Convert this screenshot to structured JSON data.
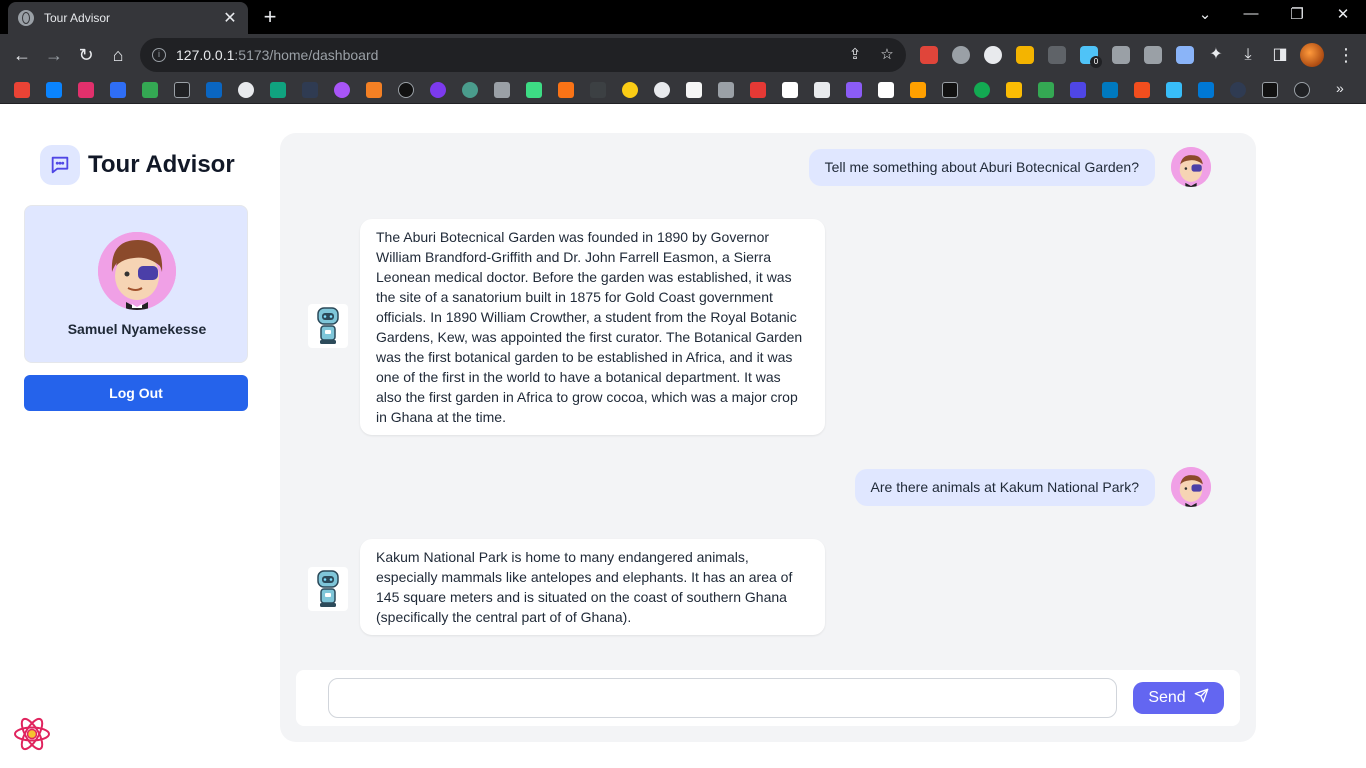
{
  "browser": {
    "tab_title": "Tour Advisor",
    "url_host": "127.0.0.1",
    "url_path": ":5173/home/dashboard",
    "extension_badge": "0"
  },
  "sidebar": {
    "brand_title": "Tour Advisor",
    "user_name": "Samuel Nyamekesse",
    "logout_label": "Log Out"
  },
  "chat": {
    "messages": [
      {
        "role": "user",
        "text": "Tell me something about Aburi Botecnical Garden?"
      },
      {
        "role": "bot",
        "text": "The Aburi Botecnical Garden was founded in 1890 by Governor William Brandford-Griffith and Dr. John Farrell Easmon, a Sierra Leonean medical doctor. Before the garden was established, it was the site of a sanatorium built in 1875 for Gold Coast government officials. In 1890 William Crowther, a student from the Royal Botanic Gardens, Kew, was appointed the first curator. The Botanical Garden was the first botanical garden to be established in Africa, and it was one of the first in the world to have a botanical department. It was also the first garden in Africa to grow cocoa, which was a major crop in Ghana at the time."
      },
      {
        "role": "user",
        "text": "Are there animals at Kakum National Park?"
      },
      {
        "role": "bot",
        "text": "Kakum National Park is home to many endangered animals, especially mammals like antelopes and elephants. It has an area of 145 square meters and is situated on the coast of southern Ghana (specifically the central part of of Ghana)."
      }
    ],
    "input_value": "",
    "send_label": "Send"
  },
  "colors": {
    "primary": "#2563eb",
    "send": "#6366f1",
    "user_bubble": "#e0e7ff",
    "panel": "#f3f4f6"
  }
}
